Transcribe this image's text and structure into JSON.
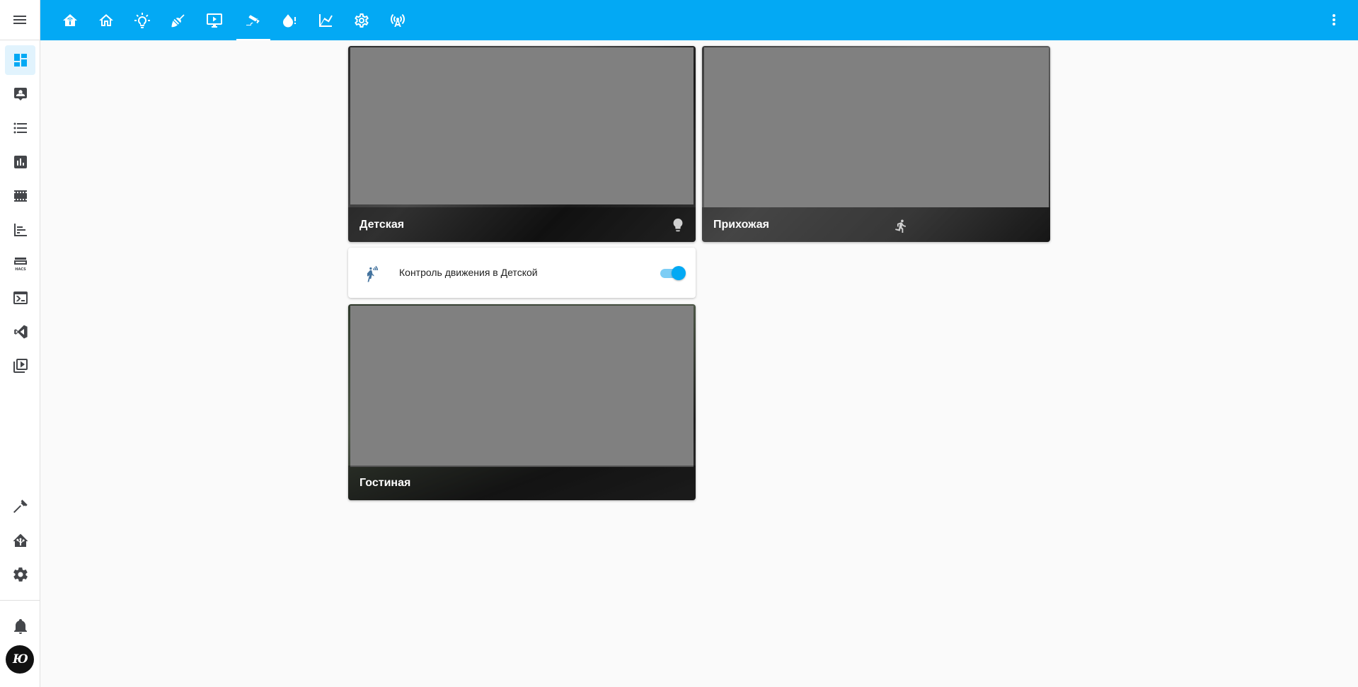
{
  "app": {
    "accent_color": "#03a9f4",
    "user_initials": "Ю"
  },
  "sidebar": {
    "menu_icon": "hamburger-icon",
    "items": [
      {
        "id": "overview",
        "icon": "dashboard-icon",
        "active": true
      },
      {
        "id": "map",
        "icon": "account-box-icon"
      },
      {
        "id": "logbook",
        "icon": "list-icon"
      },
      {
        "id": "history",
        "icon": "chart-box-icon"
      },
      {
        "id": "media",
        "icon": "filmstrip-icon"
      },
      {
        "id": "energy",
        "icon": "timeline-icon"
      },
      {
        "id": "hacs",
        "icon": "hacs-icon"
      },
      {
        "id": "terminal",
        "icon": "console-icon"
      },
      {
        "id": "vscode",
        "icon": "vscode-icon"
      },
      {
        "id": "media-browser",
        "icon": "play-box-multiple-icon"
      }
    ],
    "bottom_items": [
      {
        "id": "developer-tools",
        "icon": "hammer-icon"
      },
      {
        "id": "supervisor",
        "icon": "home-assistant-icon"
      },
      {
        "id": "settings",
        "icon": "gear-icon"
      },
      {
        "id": "notifications",
        "icon": "bell-icon"
      }
    ]
  },
  "topbar": {
    "tabs": [
      {
        "id": "automation",
        "icon": "home-automation-icon"
      },
      {
        "id": "home",
        "icon": "home-outline-icon"
      },
      {
        "id": "lights",
        "icon": "lightbulb-icon"
      },
      {
        "id": "vacuum",
        "icon": "broom-icon"
      },
      {
        "id": "tv",
        "icon": "monitor-play-icon"
      },
      {
        "id": "cameras",
        "icon": "cctv-icon",
        "active": true
      },
      {
        "id": "water",
        "icon": "water-alert-icon"
      },
      {
        "id": "graphs",
        "icon": "chart-line-icon"
      },
      {
        "id": "settings",
        "icon": "gear-outline-icon"
      },
      {
        "id": "access-point",
        "icon": "access-point-icon"
      }
    ],
    "menu_icon": "dots-vertical-icon"
  },
  "cards": {
    "camera_kids": {
      "name": "Детская",
      "status_icon": "lightbulb-icon"
    },
    "camera_hallway": {
      "name": "Прихожая",
      "status_icon": "walk-icon"
    },
    "motion_control": {
      "label": "Контроль движения в Детской",
      "icon": "motion-sensor-icon",
      "state": "on"
    },
    "camera_living": {
      "name": "Гостиная"
    }
  }
}
